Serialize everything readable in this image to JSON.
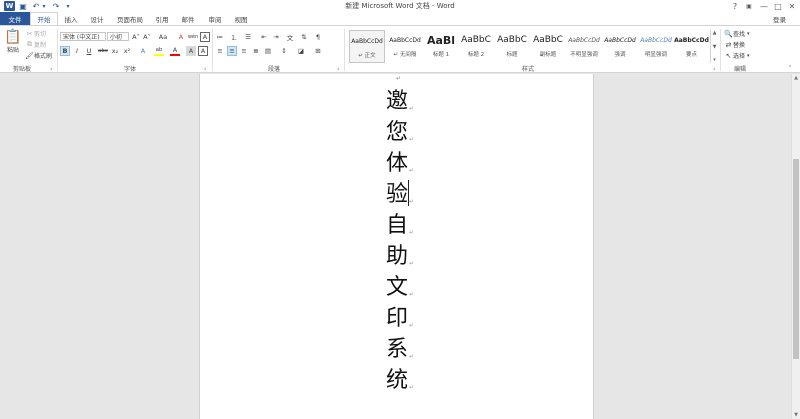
{
  "window": {
    "title": "新建 Microsoft Word 文档 - Word",
    "app_icon": "W",
    "help": "?",
    "minimize": "—",
    "maximize": "□",
    "close": "✕"
  },
  "quick_access": {
    "save": "▣",
    "undo": "↶",
    "undo_arrow": "▾",
    "redo": "↷",
    "customize": "▾"
  },
  "tabs": [
    "文件",
    "开始",
    "插入",
    "设计",
    "页面布局",
    "引用",
    "邮件",
    "审阅",
    "视图"
  ],
  "sign_in": "登录",
  "clipboard": {
    "paste": "粘贴",
    "cut": "剪切",
    "copy": "复制",
    "format_painter": "格式刷",
    "group": "剪贴板"
  },
  "font": {
    "name": "宋体 (中文正)",
    "size": "小初",
    "grow": "A˄",
    "shrink": "A˅",
    "case": "Aa",
    "clear": "A",
    "phonetic": "wén",
    "border": "A",
    "bold": "B",
    "italic": "I",
    "underline": "U",
    "strike": "abc",
    "subscript": "x₂",
    "superscript": "x²",
    "effects": "A",
    "highlight": "ab",
    "color": "A",
    "shading": "A",
    "charborder": "A",
    "group": "字体"
  },
  "paragraph": {
    "group": "段落"
  },
  "styles": {
    "group": "样式",
    "items": [
      {
        "preview": "AaBbCcDd",
        "name": "↵ 正文"
      },
      {
        "preview": "AaBbCcDd",
        "name": "↵ 无间隔"
      },
      {
        "preview": "AaBl",
        "name": "标题 1"
      },
      {
        "preview": "AaBbC",
        "name": "标题 2"
      },
      {
        "preview": "AaBbC",
        "name": "标题"
      },
      {
        "preview": "AaBbC",
        "name": "副标题"
      },
      {
        "preview": "AaBbCcDd",
        "name": "不明显强调"
      },
      {
        "preview": "AaBbCcDd",
        "name": "强调"
      },
      {
        "preview": "AaBbCcDd",
        "name": "明显强调"
      },
      {
        "preview": "AaBbCcDd",
        "name": "要点"
      }
    ]
  },
  "editing": {
    "find": "查找",
    "replace": "替换",
    "select": "选择",
    "group": "编辑"
  },
  "document": {
    "paragraph_mark": "↵",
    "characters": [
      "邀",
      "您",
      "体",
      "验",
      "自",
      "助",
      "文",
      "印",
      "系",
      "统"
    ]
  },
  "colors": {
    "accent": "#2b579a",
    "highlight": "#ffff00",
    "font_color": "#ff0000"
  }
}
